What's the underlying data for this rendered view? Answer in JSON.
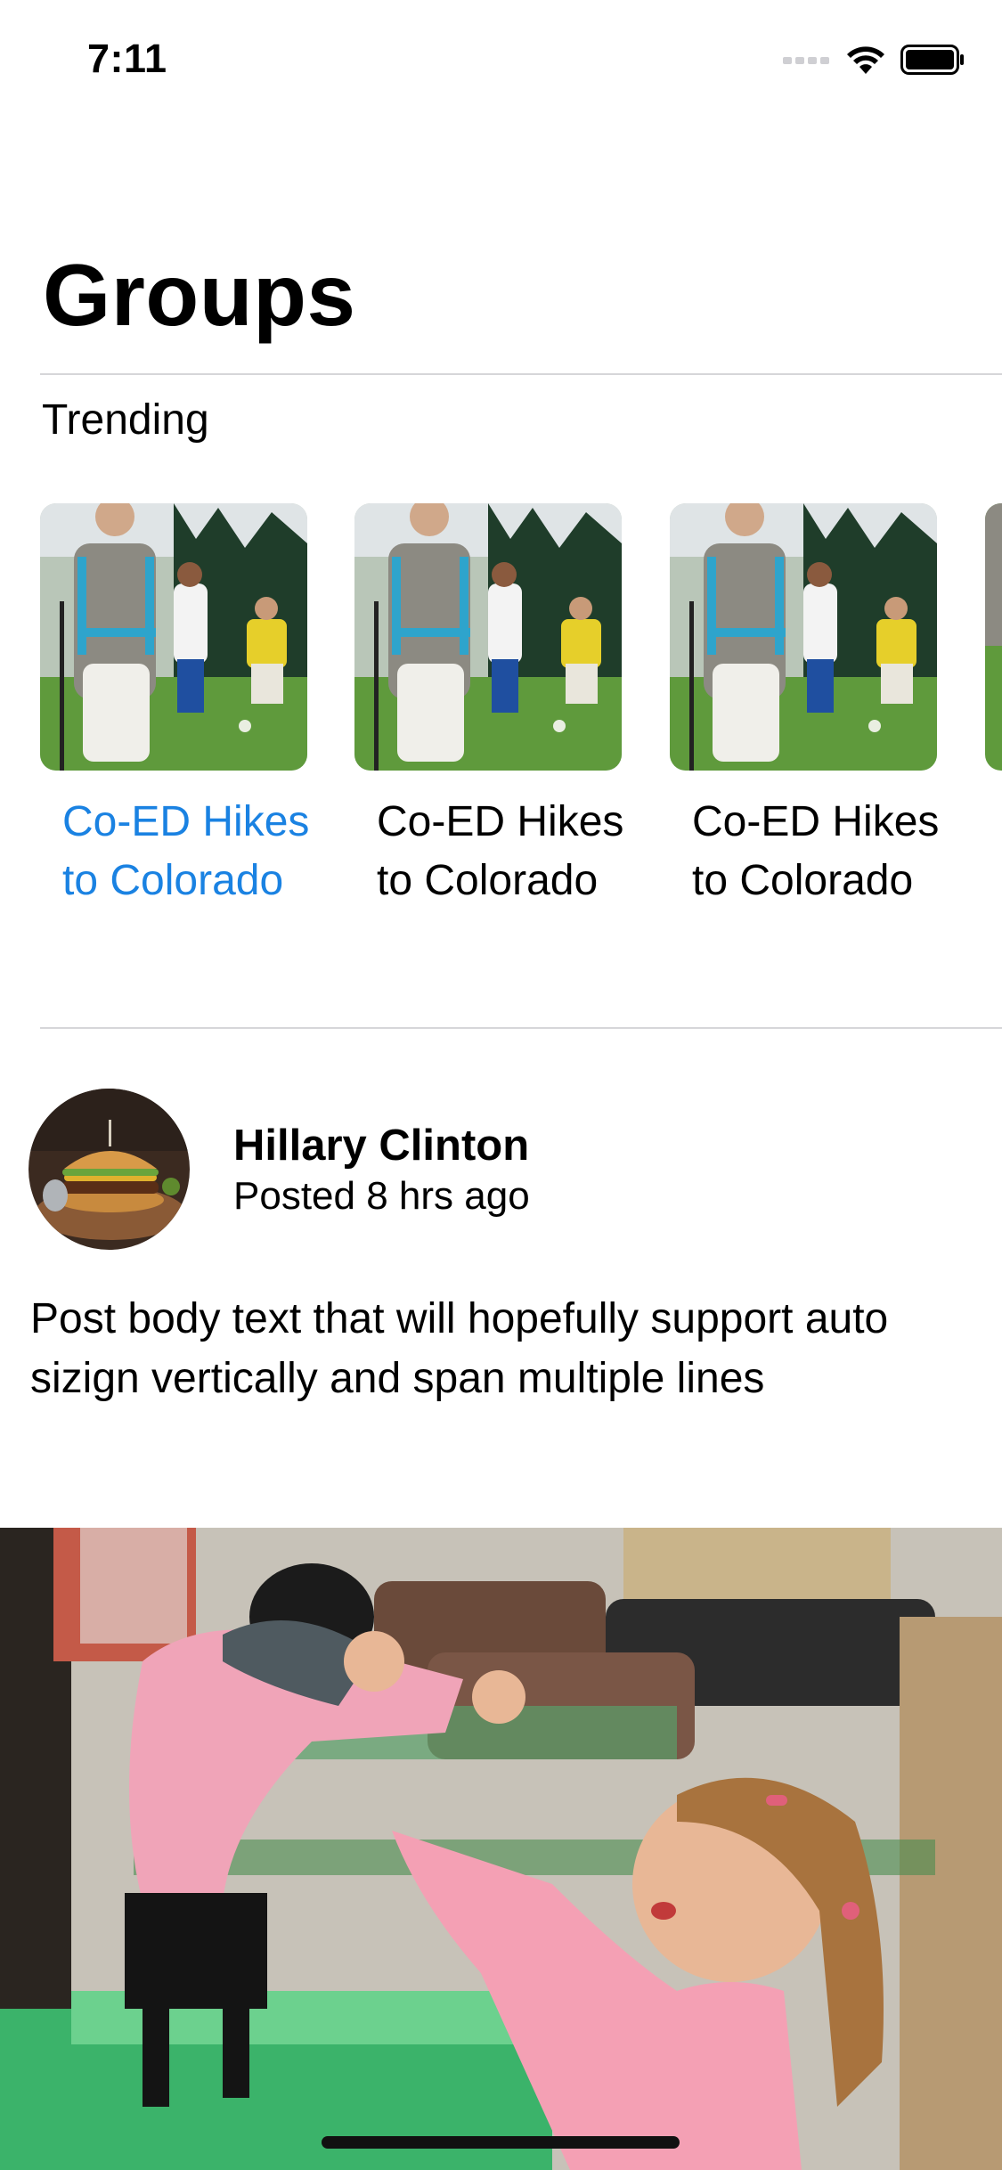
{
  "status_bar": {
    "time": "7:11",
    "icons": [
      "cellular-signal-icon",
      "wifi-icon",
      "battery-icon"
    ]
  },
  "header": {
    "title": "Groups"
  },
  "trending": {
    "label": "Trending",
    "items": [
      {
        "title": "Co-ED Hikes to Colorado",
        "image": "hikers-photo",
        "selected": true
      },
      {
        "title": "Co-ED Hikes to Colorado",
        "image": "hikers-photo",
        "selected": false
      },
      {
        "title": "Co-ED Hikes to Colorado",
        "image": "hikers-photo",
        "selected": false
      }
    ]
  },
  "post": {
    "author": "Hillary Clinton",
    "timestamp": "Posted 8 hrs ago",
    "body": "Post body text that will hopefully support auto sizign vertically and span multiple lines",
    "avatar": "burger-photo",
    "image": "girl-with-pug-photo"
  },
  "colors": {
    "accent": "#1a82e2",
    "text": "#000000",
    "divider": "#d6d6d9"
  }
}
